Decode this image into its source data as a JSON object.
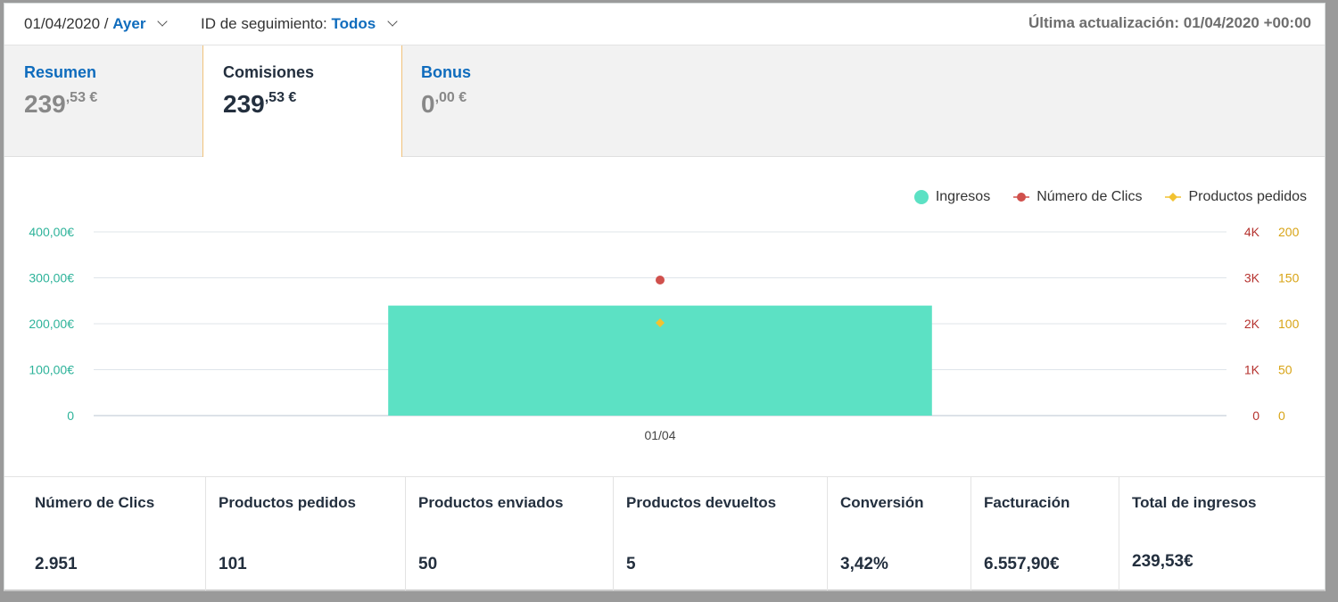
{
  "filters": {
    "date": "01/04/2020 /",
    "date_value": "Ayer",
    "tracking_label": "ID de seguimiento:",
    "tracking_value": "Todos",
    "last_update": "Última actualización: 01/04/2020 +00:00"
  },
  "tabs": [
    {
      "title": "Resumen",
      "int": "239",
      "dec": ",53 €"
    },
    {
      "title": "Comisiones",
      "int": "239",
      "dec": ",53 €"
    },
    {
      "title": "Bonus",
      "int": "0",
      "dec": ",00 €"
    }
  ],
  "legend": {
    "ingresos": "Ingresos",
    "clics": "Número de Clics",
    "productos": "Productos pedidos"
  },
  "colors": {
    "ingresos": "#5ce1c4",
    "clics": "#d0504c",
    "productos": "#f2c230",
    "link": "#0f6cbd",
    "active_border": "#f0c27a"
  },
  "chart_data": {
    "type": "bar",
    "categories": [
      "01/04"
    ],
    "series": [
      {
        "name": "Ingresos",
        "type": "bar",
        "axis": "left",
        "values": [
          239.53
        ]
      },
      {
        "name": "Número de Clics",
        "type": "scatter",
        "axis": "right1",
        "values": [
          2951
        ]
      },
      {
        "name": "Productos pedidos",
        "type": "scatter",
        "axis": "right2",
        "values": [
          101
        ]
      }
    ],
    "y_left": {
      "ticks": [
        "0",
        "100,00€",
        "200,00€",
        "300,00€",
        "400,00€"
      ],
      "ylim": [
        0,
        400
      ]
    },
    "y_right1": {
      "ticks": [
        "0",
        "1K",
        "2K",
        "3K",
        "4K"
      ],
      "ylim": [
        0,
        4000
      ]
    },
    "y_right2": {
      "ticks": [
        "0",
        "50",
        "100",
        "150",
        "200"
      ],
      "ylim": [
        0,
        200
      ]
    },
    "grid": true,
    "legend_position": "top-right"
  },
  "metrics": [
    {
      "label": "Número de Clics",
      "value": "2.951"
    },
    {
      "label": "Productos pedidos",
      "value": "101"
    },
    {
      "label": "Productos enviados",
      "value": "50"
    },
    {
      "label": "Productos devueltos",
      "value": "5"
    },
    {
      "label": "Conversión",
      "value": "3,42%"
    },
    {
      "label": "Facturación",
      "value": "6.557,90€"
    },
    {
      "label": "Total de ingresos",
      "value": "239,53€"
    }
  ]
}
